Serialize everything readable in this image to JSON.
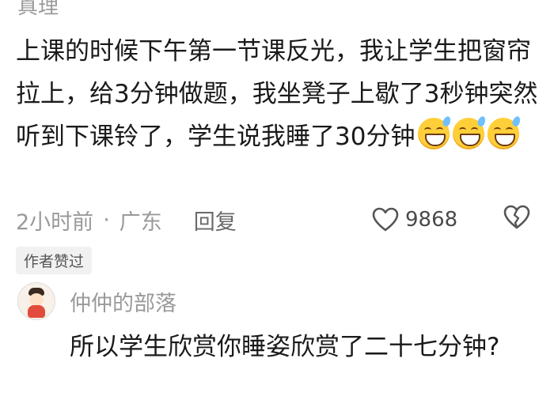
{
  "comment": {
    "author_name_partial": "真理",
    "text": "上课的时候下午第一节课反光，我让学生把窗帘拉上，给3分钟做题，我坐凳子上歇了3秒钟突然听到下课铃了，学生说我睡了30分钟",
    "emojis": [
      "sweat-grin-emoji",
      "sweat-grin-emoji",
      "sweat-grin-emoji"
    ],
    "time": "2小时前",
    "separator": "·",
    "location": "广东",
    "reply_label": "回复",
    "like_count": "9868",
    "author_liked_badge": "作者赞过"
  },
  "reply": {
    "author_name": "仲仲的部落",
    "text": "所以学生欣赏你睡姿欣赏了二十七分钟?"
  },
  "icons": {
    "like": "heart-outline-icon",
    "dislike": "broken-heart-icon"
  },
  "colors": {
    "text": "#1a1a1a",
    "muted": "#9a9a9a",
    "badge_bg": "#f1f1f1",
    "emoji": "#ffcf3a"
  }
}
